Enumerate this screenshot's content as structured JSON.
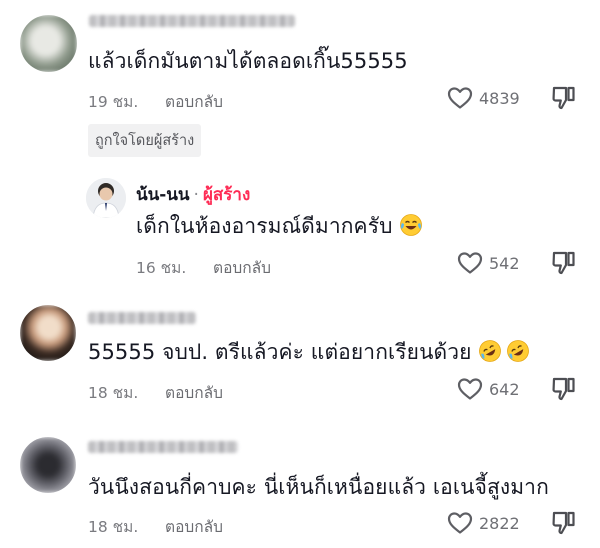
{
  "comments": [
    {
      "text": "แล้วเด็กมันตามได้ตลอดเกิ๊น55555",
      "time": "19 ชม.",
      "reply_label": "ตอบกลับ",
      "likes": "4839",
      "creator_liked": "ถูกใจโดยผู้สร้าง"
    },
    {
      "text": "55555 จบป. ตรีแล้วค่ะ แต่อยากเรียนด้วย",
      "time": "18 ชม.",
      "reply_label": "ตอบกลับ",
      "likes": "642"
    },
    {
      "text": "วันนึงสอนกี่คาบคะ นี่เห็นก็เหนื่อยแล้ว เอเนจี้สูงมาก",
      "time": "18 ชม.",
      "reply_label": "ตอบกลับ",
      "likes": "2822"
    }
  ],
  "reply": {
    "name": "น้น-นน",
    "separator": "·",
    "creator_tag": "ผู้สร้าง",
    "text": "เด็กในห้องอารมณ์ดีมากครับ",
    "time": "16 ชม.",
    "reply_label": "ตอบกลับ",
    "likes": "542"
  },
  "icons": {
    "like": "heart-outline-icon",
    "dislike": "thumbs-down-icon",
    "emoji_laugh": "tears-of-joy-emoji",
    "emoji_rofl": "rolling-on-floor-laughing-emoji"
  },
  "colors": {
    "creator_tag": "#fe2c55",
    "meta_text": "#7a7b80",
    "primary_text": "#161823"
  }
}
